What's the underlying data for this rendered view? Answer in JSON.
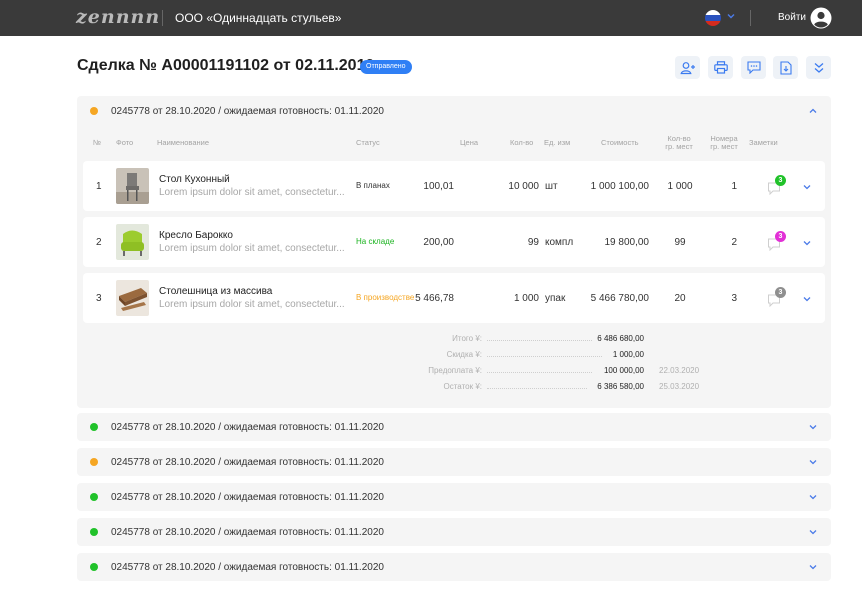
{
  "topbar": {
    "logo": "zennnn",
    "company": "ООО «Одиннадцать стульев»",
    "login_label": "Войти",
    "flag_colors": [
      "#ffffff",
      "#2a52be",
      "#d52b1e"
    ]
  },
  "header": {
    "title": "Сделка № А00001191102 от 02.11.2019",
    "status": "Отправлено",
    "status_color": "#2f7ff5",
    "tools": [
      "add-user-icon",
      "print-icon",
      "comment-icon",
      "document-icon",
      "expand-all-icon"
    ]
  },
  "expanded_order": {
    "label": "0245778 от 28.10.2020 / ожидаемая готовность: 01.11.2020",
    "dot_color": "#f5a623",
    "columns": {
      "num": "№",
      "photo": "Фото",
      "name": "Наименование",
      "status": "Статус",
      "price": "Цена",
      "qty": "Кол-во",
      "unit": "Ед. изм",
      "cost": "Стоимость",
      "places1": "Кол-во",
      "places2": "гр. мест",
      "numbers1": "Номера",
      "numbers2": "гр. мест",
      "notes": "Заметки"
    },
    "items": [
      {
        "num": "1",
        "name": "Стол Кухонный",
        "desc": "Lorem ipsum dolor sit amet, consectetur...",
        "status": "В планах",
        "status_color": "#333333",
        "price": "100,01",
        "qty": "10 000",
        "unit": "шт",
        "cost": "1 000 100,00",
        "places": "1 000",
        "numbers": "1",
        "notes_count": "3",
        "badge_color": "#21c22a"
      },
      {
        "num": "2",
        "name": "Кресло Барокко",
        "desc": "Lorem ipsum dolor sit amet, consectetur...",
        "status": "На складе",
        "status_color": "#1ab31f",
        "price": "200,00",
        "qty": "99",
        "unit": "компл",
        "cost": "19 800,00",
        "places": "99",
        "numbers": "2",
        "notes_count": "3",
        "badge_color": "#e230d6"
      },
      {
        "num": "3",
        "name": "Столешница из массива",
        "desc": "Lorem ipsum dolor sit amet, consectetur...",
        "status": "В производстве",
        "status_color": "#f5a623",
        "price": "5 466,78",
        "qty": "1 000",
        "unit": "упак",
        "cost": "5 466 780,00",
        "places": "20",
        "numbers": "3",
        "notes_count": "3",
        "badge_color": "#8f8f8f"
      }
    ],
    "summary": {
      "total_label": "Итого ¥:",
      "total": "6 486 680,00",
      "discount_label": "Скидка ¥:",
      "discount": "1 000,00",
      "prepay_label": "Предоплата ¥:",
      "prepay": "100 000,00",
      "prepay_date": "22.03.2020",
      "rest_label": "Остаток ¥:",
      "rest": "6 386 580,00",
      "rest_date": "25.03.2020"
    }
  },
  "orders": [
    {
      "label": "0245778 от 28.10.2020 / ожидаемая готовность: 01.11.2020",
      "dot_color": "#21c22a"
    },
    {
      "label": "0245778 от 28.10.2020 / ожидаемая готовность: 01.11.2020",
      "dot_color": "#f5a623"
    },
    {
      "label": "0245778 от 28.10.2020 / ожидаемая готовность: 01.11.2020",
      "dot_color": "#21c22a"
    },
    {
      "label": "0245778 от 28.10.2020 / ожидаемая готовность: 01.11.2020",
      "dot_color": "#21c22a"
    },
    {
      "label": "0245778 от 28.10.2020 / ожидаемая готовность: 01.11.2020",
      "dot_color": "#21c22a"
    }
  ]
}
